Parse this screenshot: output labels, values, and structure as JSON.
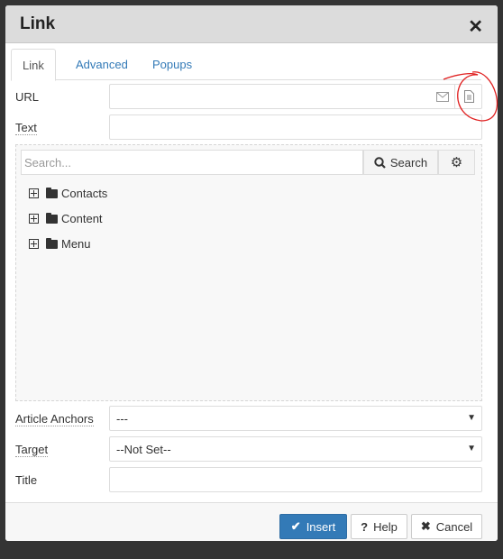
{
  "dialog": {
    "title": "Link",
    "close_icon": "close-icon"
  },
  "tabs": [
    {
      "label": "Link",
      "active": true
    },
    {
      "label": "Advanced"
    },
    {
      "label": "Popups"
    }
  ],
  "fields": {
    "url": {
      "label": "URL",
      "value": ""
    },
    "text": {
      "label": "Text",
      "value": ""
    },
    "article_anchors": {
      "label": "Article Anchors",
      "value": "---"
    },
    "target": {
      "label": "Target",
      "value": "--Not Set--"
    },
    "title": {
      "label": "Title",
      "value": ""
    }
  },
  "browser": {
    "search_placeholder": "Search...",
    "search_label": "Search",
    "tree": [
      {
        "label": "Contacts"
      },
      {
        "label": "Content"
      },
      {
        "label": "Menu"
      }
    ]
  },
  "footer": {
    "insert": "Insert",
    "help": "Help",
    "cancel": "Cancel"
  },
  "colors": {
    "primary": "#337ab7",
    "annotation": "#e02020"
  }
}
